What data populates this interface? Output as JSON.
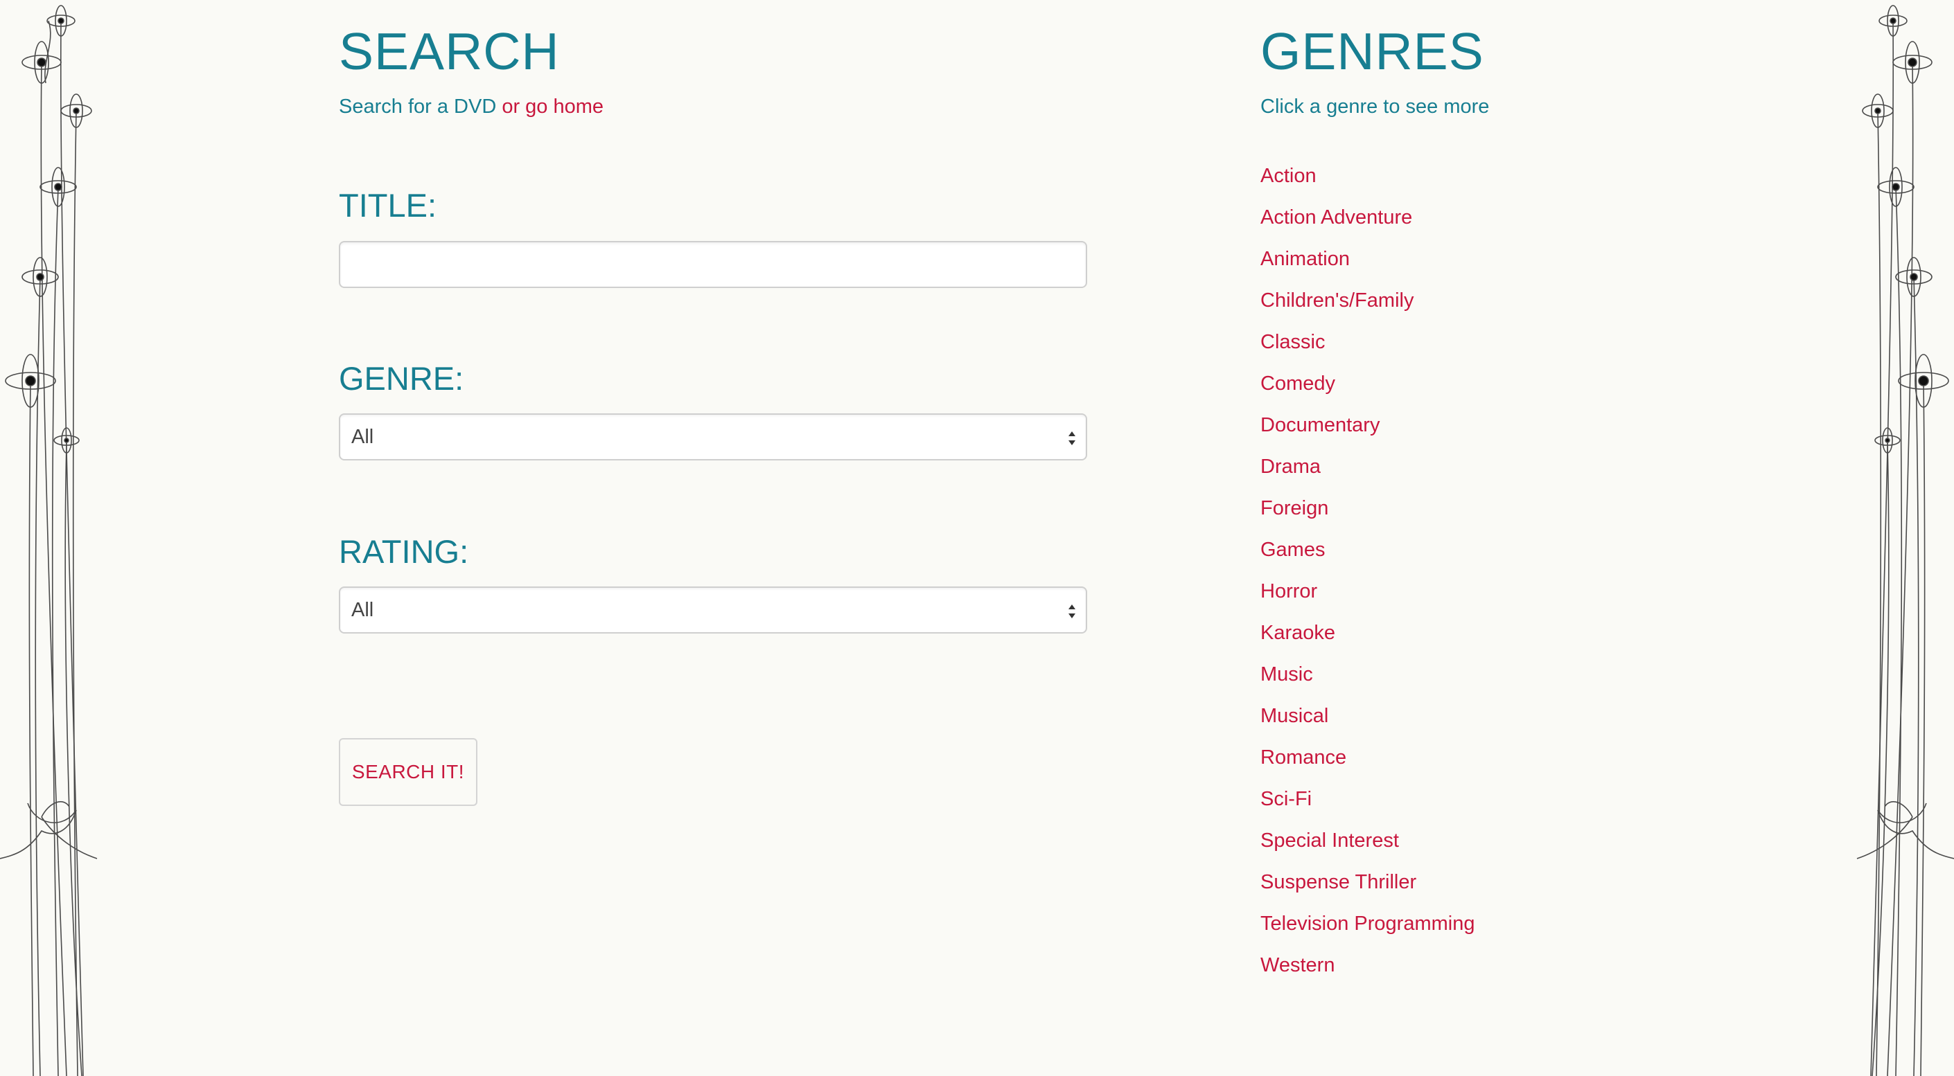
{
  "search": {
    "title": "SEARCH",
    "subtitle_prefix": "Search for a DVD",
    "subtitle_joiner": " or ",
    "home_link": "go home",
    "title_label": "TITLE:",
    "title_value": "",
    "genre_label": "GENRE:",
    "genre_selected": "All",
    "rating_label": "RATING:",
    "rating_selected": "All",
    "submit_label": "SEARCH IT!"
  },
  "genres": {
    "title": "GENRES",
    "subtitle": "Click a genre to see more",
    "items": [
      "Action",
      "Action Adventure",
      "Animation",
      "Children's/Family",
      "Classic",
      "Comedy",
      "Documentary",
      "Drama",
      "Foreign",
      "Games",
      "Horror",
      "Karaoke",
      "Music",
      "Musical",
      "Romance",
      "Sci-Fi",
      "Special Interest",
      "Suspense Thriller",
      "Television Programming",
      "Western"
    ]
  },
  "theme": {
    "heading_color": "#177e91",
    "link_color": "#c8173d",
    "background": "#fafaf6"
  },
  "icons": {
    "decoration": "flower-bouquet-icon",
    "select_arrows": "updown-arrows-icon"
  }
}
